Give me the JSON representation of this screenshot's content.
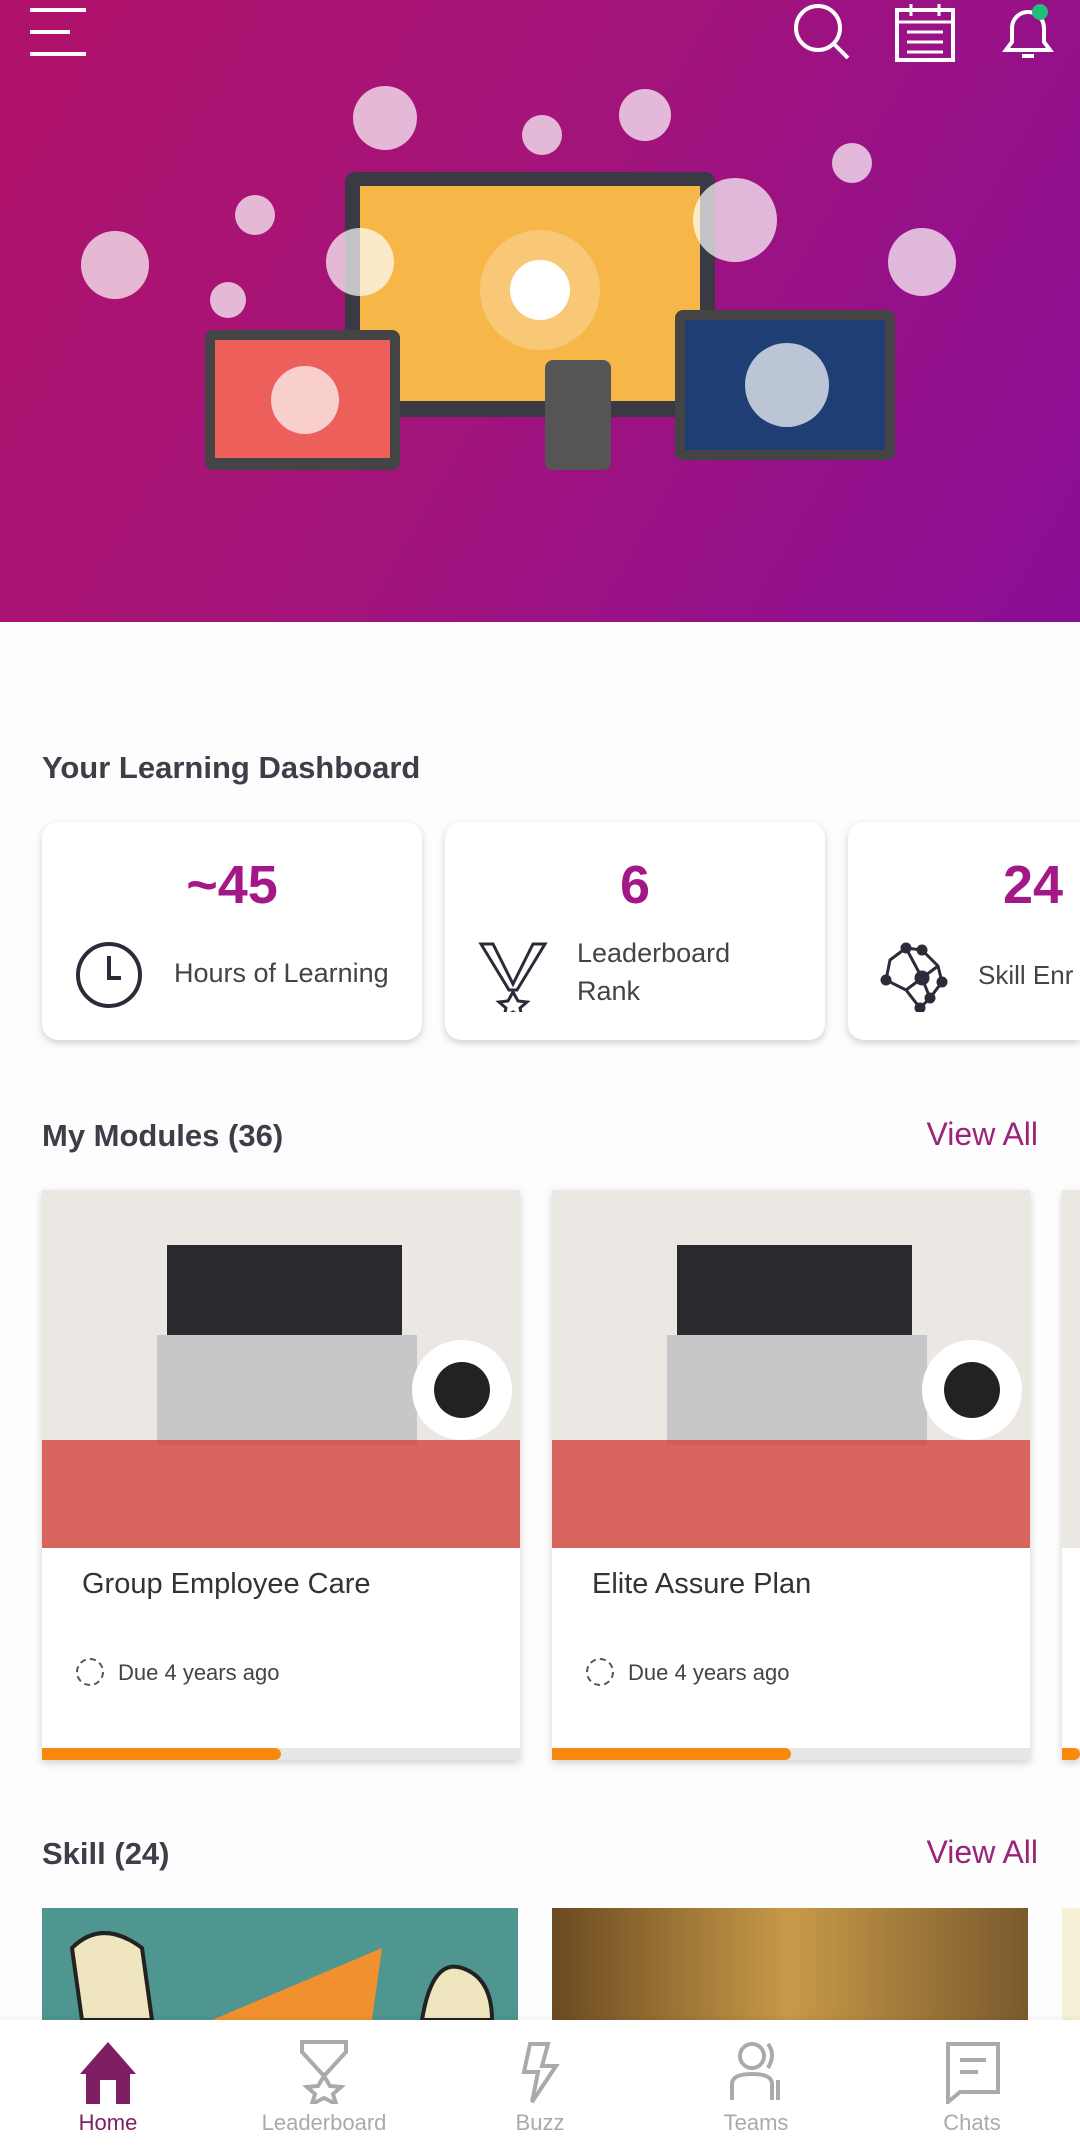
{
  "header": {
    "icons": [
      "menu-icon",
      "search-icon",
      "calendar-icon",
      "notification-bell-icon"
    ],
    "notification_dot_color": "#1fc07a"
  },
  "dashboard": {
    "title": "Your Learning Dashboard",
    "stats": [
      {
        "value": "~45",
        "label": "Hours of Learning",
        "icon": "clock-icon"
      },
      {
        "value": "6",
        "label": "Leaderboard Rank",
        "icon": "medal-icon"
      },
      {
        "value": "24",
        "label": "Skill Enr",
        "icon": "brain-network-icon"
      }
    ]
  },
  "modules": {
    "title": "My Modules (36)",
    "view_all": "View All",
    "items": [
      {
        "title": "Group Employee Care",
        "due": "Due 4 years ago",
        "progress": 0.5
      },
      {
        "title": "Elite Assure Plan",
        "due": "Due 4 years ago",
        "progress": 0.5
      }
    ]
  },
  "skills": {
    "title": "Skill (24)",
    "view_all": "View All"
  },
  "nav": {
    "items": [
      {
        "label": "Home",
        "active": true
      },
      {
        "label": "Leaderboard"
      },
      {
        "label": "Buzz"
      },
      {
        "label": "Teams"
      },
      {
        "label": "Chats"
      }
    ]
  },
  "colors": {
    "accent": "#a31886",
    "progress": "#f7890f",
    "nav_active": "#7e1e63"
  }
}
